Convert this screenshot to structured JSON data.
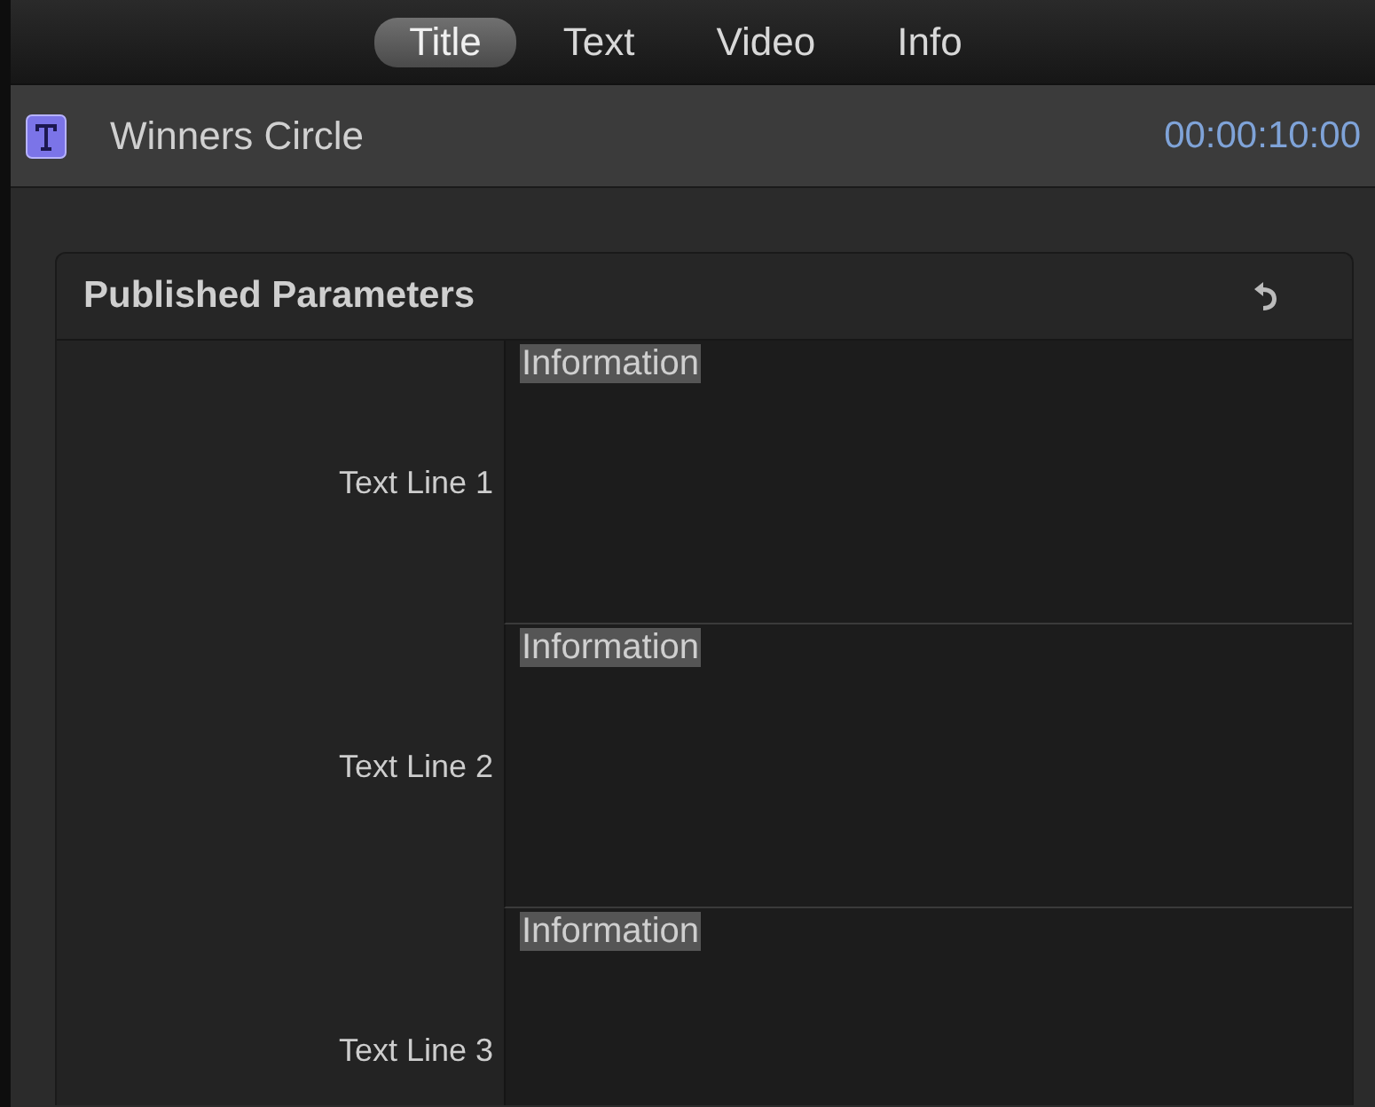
{
  "tabs": [
    {
      "label": "Title",
      "selected": true
    },
    {
      "label": "Text",
      "selected": false
    },
    {
      "label": "Video",
      "selected": false
    },
    {
      "label": "Info",
      "selected": false
    }
  ],
  "header": {
    "title": "Winners Circle",
    "duration": "00:00:10:00"
  },
  "panel": {
    "title": "Published Parameters",
    "parameters": [
      {
        "label": "Text Line 1",
        "value": "Information",
        "selected": true
      },
      {
        "label": "Text Line 2",
        "value": "Information",
        "selected": true
      },
      {
        "label": "Text Line 3",
        "value": "Information",
        "selected": true
      }
    ]
  }
}
